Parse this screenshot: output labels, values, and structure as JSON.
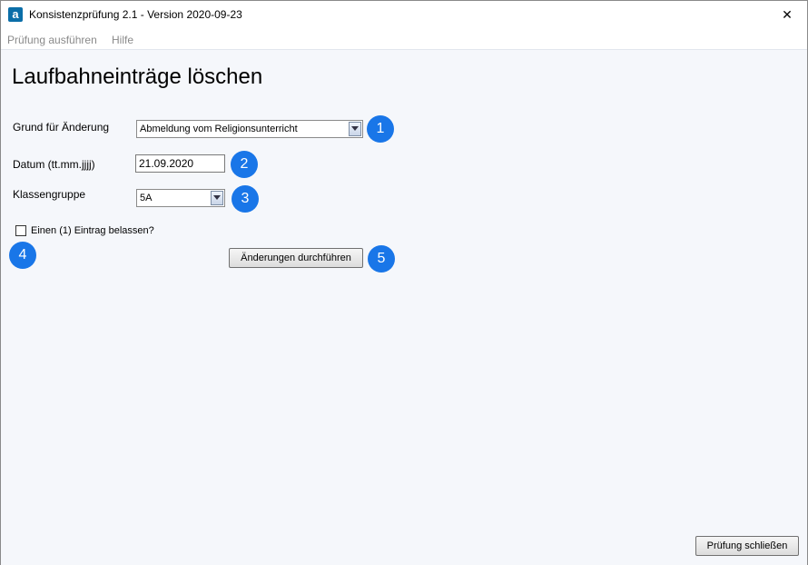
{
  "window": {
    "title": "Konsistenzprüfung 2.1 - Version 2020-09-23",
    "app_icon_letter": "a",
    "close_glyph": "✕"
  },
  "menu": [
    {
      "label": "Prüfung ausführen"
    },
    {
      "label": "Hilfe"
    }
  ],
  "page": {
    "title": "Laufbahneinträge löschen"
  },
  "form": {
    "reason": {
      "label": "Grund für Änderung",
      "value": "Abmeldung vom Religionsunterricht"
    },
    "date": {
      "label": "Datum (tt.mm.jjjj)",
      "value": "21.09.2020"
    },
    "class_group": {
      "label": "Klassengruppe",
      "value": "5A"
    },
    "keep_entry": {
      "label": "Einen (1) Eintrag belassen?",
      "checked": false
    },
    "apply_button": "Änderungen durchführen"
  },
  "badges": [
    "1",
    "2",
    "3",
    "4",
    "5"
  ],
  "footer": {
    "close_button": "Prüfung schließen"
  },
  "colors": {
    "badge": "#1976e8",
    "content_bg": "#f5f7fb"
  },
  "icons": {
    "close": "close-icon",
    "dropdown": "chevron-down-icon",
    "app": "app-logo-icon"
  }
}
